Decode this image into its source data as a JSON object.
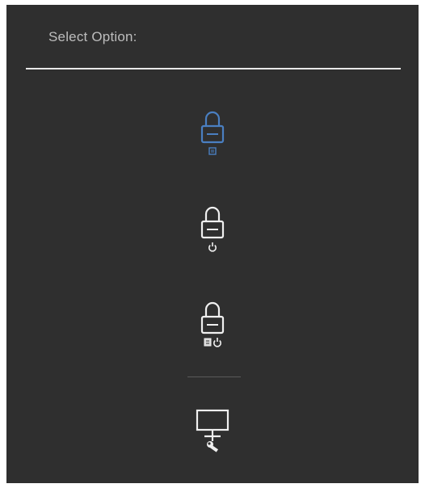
{
  "dialog": {
    "title": "Select Option:"
  },
  "colors": {
    "background": "#2f2f2f",
    "selected": "#4a7fc1",
    "normal": "#f0f0f0",
    "title_text": "#bdbdbd"
  },
  "options": [
    {
      "icon": "lock-menu-icon",
      "selected": true
    },
    {
      "icon": "lock-power-icon",
      "selected": false
    },
    {
      "icon": "lock-menu-power-icon",
      "selected": false
    },
    {
      "icon": "monitor-wrench-icon",
      "selected": false
    }
  ]
}
